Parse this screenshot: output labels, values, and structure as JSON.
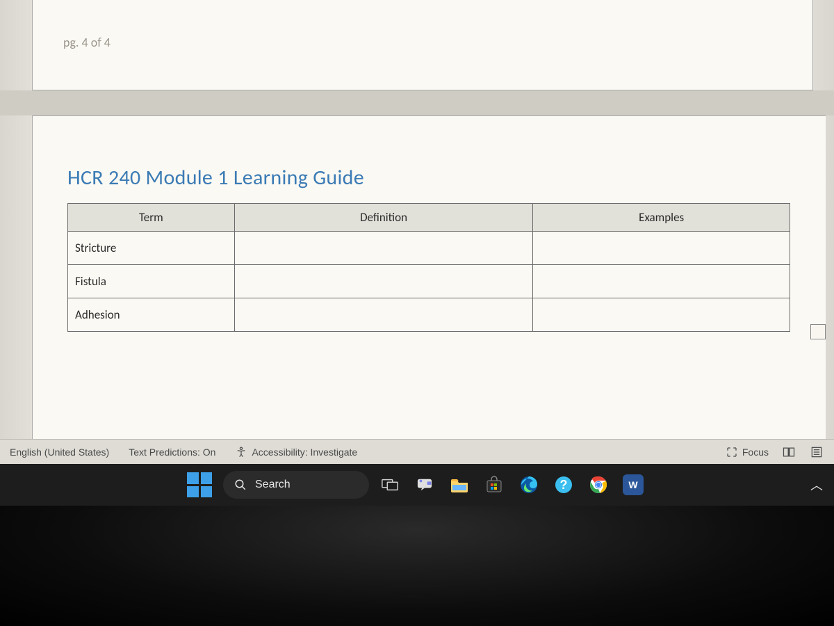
{
  "document": {
    "page_indicator": "pg. 4 of 4",
    "title": "HCR 240 Module 1 Learning Guide",
    "table": {
      "headers": {
        "term": "Term",
        "definition": "Definition",
        "examples": "Examples"
      },
      "rows": [
        {
          "term": "Stricture",
          "definition": "",
          "examples": ""
        },
        {
          "term": "Fistula",
          "definition": "",
          "examples": ""
        },
        {
          "term": "Adhesion",
          "definition": "",
          "examples": ""
        }
      ]
    }
  },
  "status_bar": {
    "language": "English (United States)",
    "predictions": "Text Predictions: On",
    "accessibility": "Accessibility: Investigate",
    "focus": "Focus"
  },
  "taskbar": {
    "search_label": "Search",
    "apps": {
      "taskview": "task-view",
      "chat": "chat",
      "explorer": "file-explorer",
      "store": "microsoft-store",
      "edge": "edge",
      "gethelp": "get-help",
      "chrome": "chrome",
      "word": "W"
    }
  }
}
